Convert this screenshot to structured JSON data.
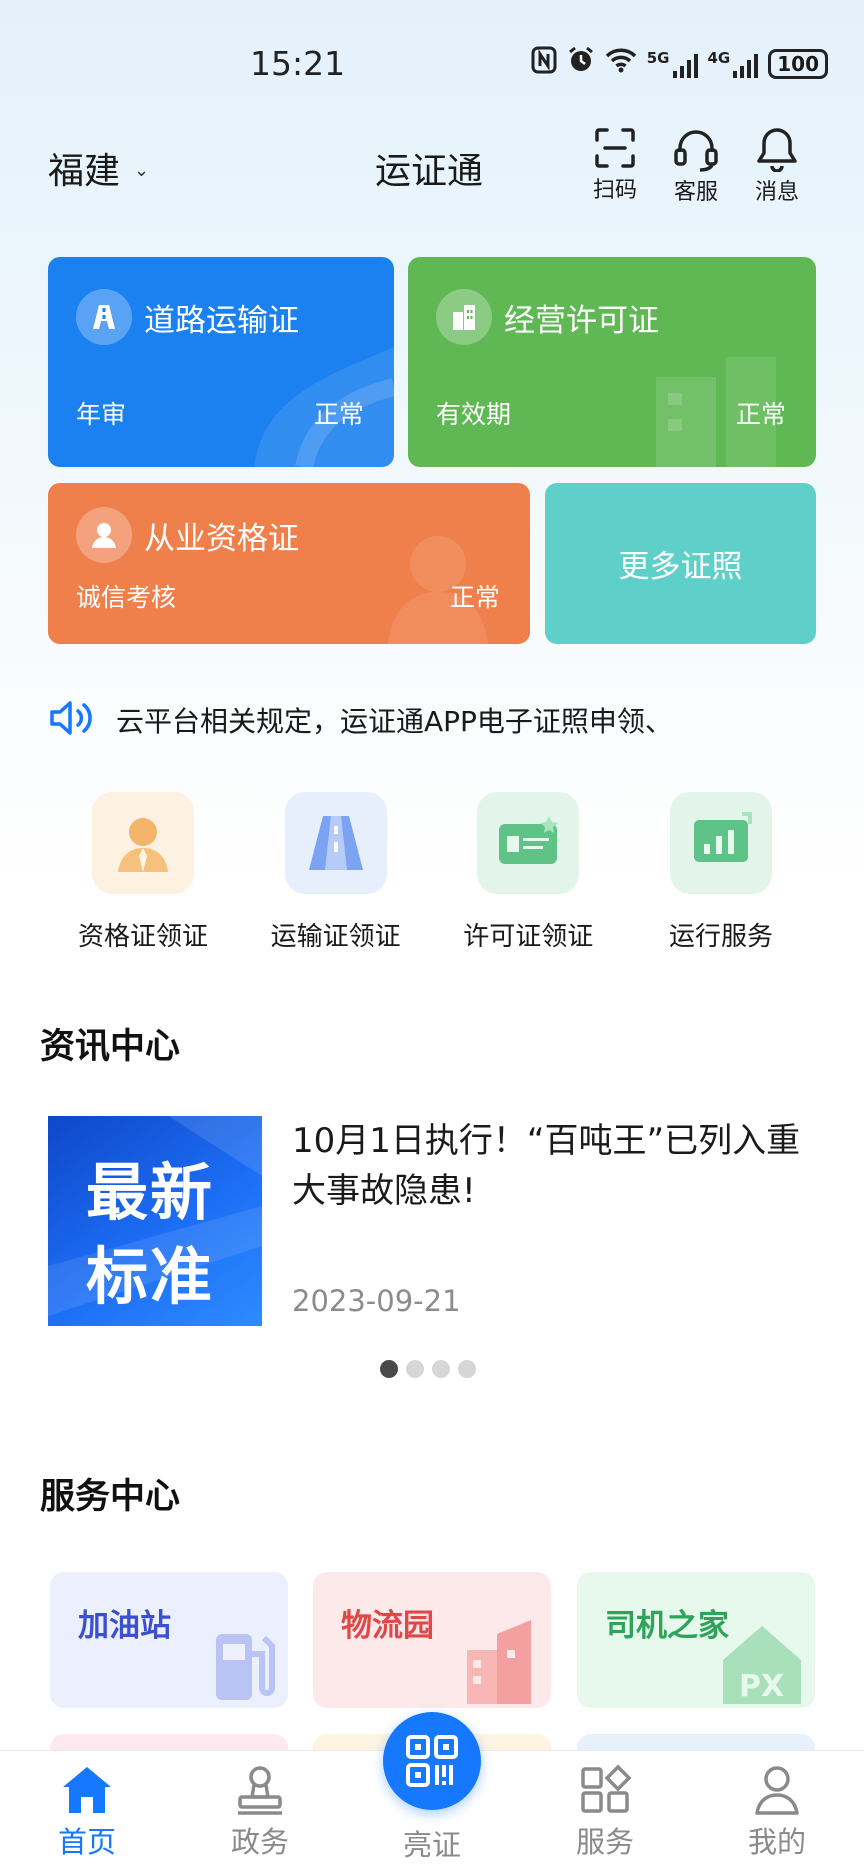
{
  "status_bar": {
    "time": "15:21",
    "battery": "100",
    "net1": "5G",
    "net2": "4G"
  },
  "header": {
    "region": "福建",
    "title": "运证通",
    "actions": [
      {
        "label": "扫码",
        "icon": "scan-icon"
      },
      {
        "label": "客服",
        "icon": "headset-icon"
      },
      {
        "label": "消息",
        "icon": "bell-icon"
      }
    ]
  },
  "cards": {
    "road": {
      "title": "道路运输证",
      "sub": "年审",
      "status": "正常",
      "color": "#1b80f0"
    },
    "business": {
      "title": "经营许可证",
      "sub": "有效期",
      "status": "正常",
      "color": "#5fb854"
    },
    "qualification": {
      "title": "从业资格证",
      "sub": "诚信考核",
      "status": "正常",
      "color": "#ef7f4b"
    },
    "more": {
      "label": "更多证照",
      "color": "#5fd0c9"
    }
  },
  "notice": {
    "text": "云平台相关规定，运证通APP电子证照申领、"
  },
  "quick_entries": [
    {
      "label": "资格证领证",
      "icon": "person-icon"
    },
    {
      "label": "运输证领证",
      "icon": "road-icon"
    },
    {
      "label": "许可证领证",
      "icon": "license-card-icon"
    },
    {
      "label": "运行服务",
      "icon": "chart-board-icon"
    }
  ],
  "news_center": {
    "title": "资讯中心",
    "item": {
      "thumb_line1": "最新",
      "thumb_line2": "标准",
      "title": "10月1日执行！“百吨王”已列入重大事故隐患!",
      "date": "2023-09-21"
    },
    "carousel_index": 1,
    "carousel_total": 4
  },
  "service_center": {
    "title": "服务中心",
    "items": [
      {
        "label": "加油站",
        "icon": "fuel-pump-icon"
      },
      {
        "label": "物流园",
        "icon": "building-icon"
      },
      {
        "label": "司机之家",
        "icon": "house-icon"
      }
    ]
  },
  "tabbar": {
    "items": [
      {
        "label": "首页",
        "icon": "home-icon",
        "active": true
      },
      {
        "label": "政务",
        "icon": "stamp-icon",
        "active": false
      },
      {
        "label": "亮证",
        "icon": "qr-code-icon",
        "active": false
      },
      {
        "label": "服务",
        "icon": "grid-icon",
        "active": false
      },
      {
        "label": "我的",
        "icon": "user-icon",
        "active": false
      }
    ]
  },
  "colors": {
    "accent": "#1677ff",
    "inactive": "#8a8a8a"
  }
}
